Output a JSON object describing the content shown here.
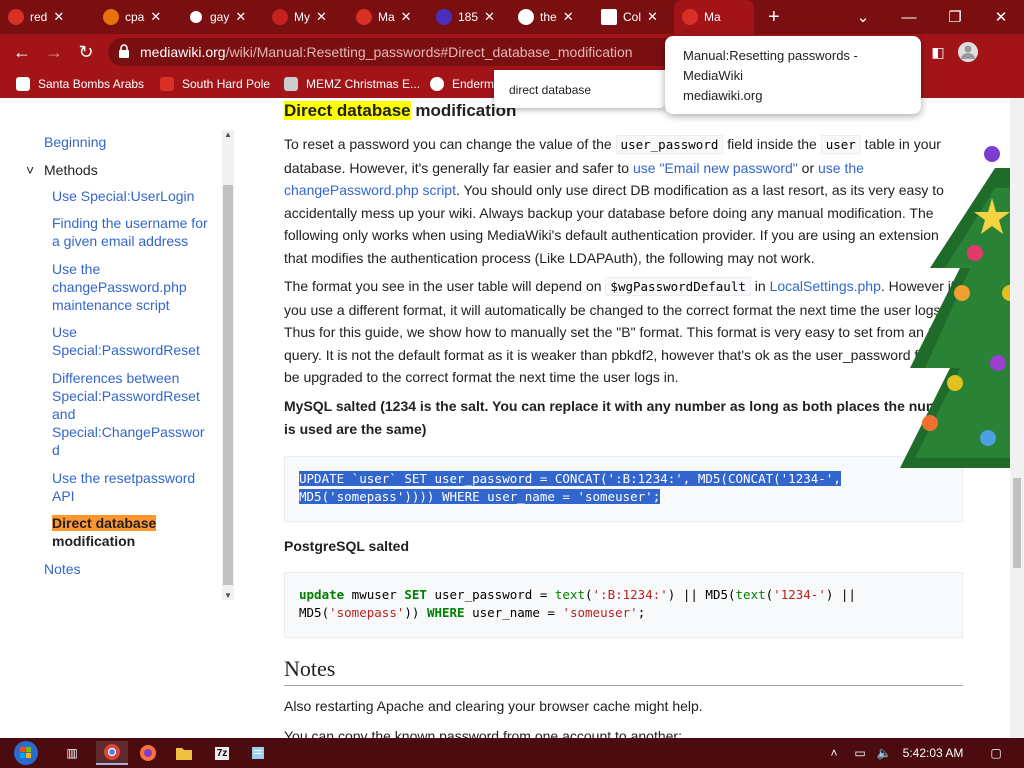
{
  "browser": {
    "tabs": [
      {
        "label": "red",
        "color": "#d93025"
      },
      {
        "label": "cpa",
        "color": "#e8710a"
      },
      {
        "label": "gay",
        "color": "#ffffff"
      },
      {
        "label": "My",
        "color": "#c5221f"
      },
      {
        "label": "Ma",
        "color": "#d93025"
      },
      {
        "label": "185",
        "color": "#4a2fbd"
      },
      {
        "label": "the",
        "color": "#ffffff"
      },
      {
        "label": "Col",
        "color": "#ffffff"
      },
      {
        "label": "Ma",
        "color": "#d93025",
        "active": true
      }
    ],
    "new_tab_symbol": "+",
    "url_host": "mediawiki.org",
    "url_path": "/wiki/Manual:Resetting_passwords#Direct_database_modification",
    "bookmarks": [
      {
        "label": "Santa Bombs Arabs",
        "color": "#ffffff"
      },
      {
        "label": "South Hard Pole",
        "color": "#d93025"
      },
      {
        "label": "MEMZ Christmas E...",
        "color": "#cccccc"
      },
      {
        "label": "Enderm",
        "color": "#ffffff"
      }
    ],
    "find_text": "direct database",
    "tooltip": {
      "title_line1": "Manual:Resetting passwords -",
      "title_line2": "MediaWiki",
      "host": "mediawiki.org"
    },
    "theme_color": "#a31418"
  },
  "toc": {
    "items": [
      {
        "label": "Beginning"
      },
      {
        "label": "Methods",
        "toggle": true
      },
      {
        "label": "Use Special:UserLogin"
      },
      {
        "label_lines": [
          "Finding the username for",
          "a given email address"
        ]
      },
      {
        "label_lines": [
          "Use the",
          "changePassword.php",
          "maintenance script"
        ]
      },
      {
        "label_lines": [
          "Use",
          "Special:PasswordReset"
        ]
      },
      {
        "label_lines": [
          "Differences between",
          "Special:PasswordReset",
          "and",
          "Special:ChangePasswor",
          "d"
        ]
      },
      {
        "label_lines": [
          "Use the resetpassword",
          "API"
        ]
      },
      {
        "label_line1_highlight": "Direct database",
        "label_line2": "modification",
        "current": true
      },
      {
        "label": "Notes"
      }
    ]
  },
  "article": {
    "heading_highlight": "Direct database",
    "heading_rest": " modification",
    "p1": {
      "t1": "To reset a password you can change the value of the ",
      "code1": "user_password",
      "t2": " field inside the ",
      "code2": "user",
      "t3": " table in your database. However, it's generally far easier and safer to ",
      "link1": "use \"Email new password\"",
      "t4": " or ",
      "link2": "use the changePassword.php script",
      "t5": ". You should only use direct DB modification as a last resort, as its very easy to accidentally mess up your wiki. Always backup your database before doing any manual modification. The following only works when using MediaWiki's default authentication provider. If you are using an extension that modifies the authentication process (Like LDAPAuth), the following may not work."
    },
    "p2": {
      "t1": "The format you see in the user table will depend on ",
      "code1": "$wgPasswordDefault",
      "t2": " in ",
      "link1": "LocalSettings.php",
      "t3": ". However if you use a different format, it will automatically be changed to the correct format the next time the user logs in. Thus for this guide, we show how to manually set the \"B\" format. This format is very easy to set from an SQL query. It is not the default format as it is weaker than pbkdf2, however that's ok as the user_password field will be upgraded to the correct format the next time the user logs in."
    },
    "mysql_label": "MySQL salted (1234 is the salt. You can replace it with any number as long as both places the number is used are the same)",
    "mysql_code_line1": "UPDATE `user` SET user_password = CONCAT(':B:1234:', MD5(CONCAT('1234-',",
    "mysql_code_line2": "MD5('somepass')))) WHERE user_name = 'someuser';",
    "pg_label": "PostgreSQL salted",
    "pg": {
      "l1_kw1": "update",
      "l1_t1": " mwuser ",
      "l1_kw2": "SET",
      "l1_t2": " user_password = ",
      "l1_fn1": "text",
      "l1_t3": "(",
      "l1_s1": "':B:1234:'",
      "l1_t4": ") || MD5(",
      "l1_fn2": "text",
      "l1_t5": "(",
      "l1_s2": "'1234-'",
      "l1_t6": ") ||",
      "l2_t1": "MD5(",
      "l2_s1": "'somepass'",
      "l2_t2": ")) ",
      "l2_kw1": "WHERE",
      "l2_t3": " user_name = ",
      "l2_s2": "'someuser'",
      "l2_t4": ";"
    },
    "notes_heading": "Notes",
    "notes_p1": "Also restarting Apache and clearing your browser cache might help.",
    "notes_p2": "You can copy the known password from one account to another:"
  },
  "taskbar": {
    "clock": "5:42:03 AM",
    "apps": [
      "start-orb",
      "task-view",
      "chrome",
      "firefox",
      "file-explorer",
      "7zip",
      "notepad"
    ]
  }
}
